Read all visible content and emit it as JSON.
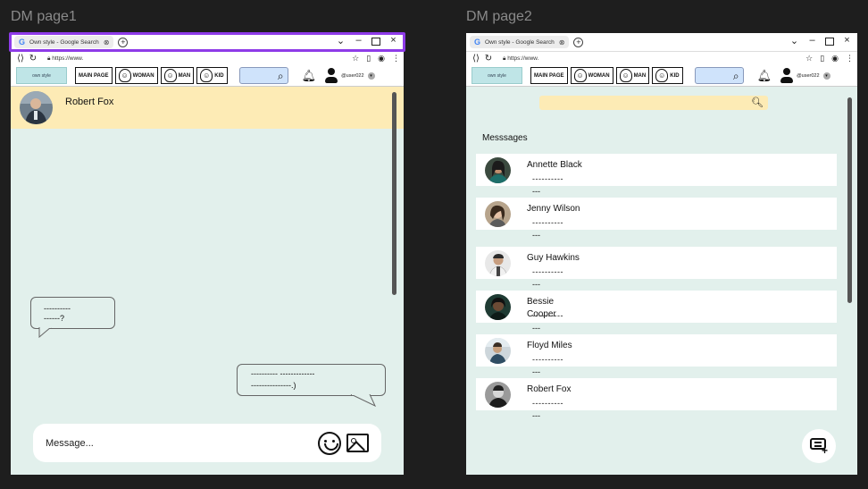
{
  "frames": [
    {
      "label": "DM page1"
    },
    {
      "label": "DM page2"
    }
  ],
  "browser": {
    "tab_title": "Own style - Google Search",
    "url": "https://www.",
    "google_letter": "G",
    "new_tab": "+",
    "close_x": "×"
  },
  "site": {
    "logo_text": "own style",
    "nav": [
      {
        "label": "MAIN PAGE",
        "icon": null
      },
      {
        "label": "WOMAN",
        "icon": "woman-face-icon"
      },
      {
        "label": "MAN",
        "icon": "man-face-icon"
      },
      {
        "label": "KID",
        "icon": "kid-face-icon"
      }
    ],
    "username": "@user022"
  },
  "dm1": {
    "contact_name": "Robert Fox",
    "received_message": "----------\n------?",
    "sent_message": "---------- -------------\n---------------.)",
    "input_placeholder": "Message..."
  },
  "dm2": {
    "section_title": "Messsages",
    "conversations": [
      {
        "name": "Annette Black",
        "preview1": "----------",
        "preview2": "---"
      },
      {
        "name": "Jenny Wilson",
        "preview1": "----------",
        "preview2": "---"
      },
      {
        "name": "Guy Hawkins",
        "preview1": "----------",
        "preview2": "---"
      },
      {
        "name": "Bessie\nCooper",
        "preview1": "----------",
        "preview2": "---"
      },
      {
        "name": "Floyd Miles",
        "preview1": "----------",
        "preview2": "---"
      },
      {
        "name": "Robert Fox",
        "preview1": "----------",
        "preview2": "---"
      }
    ]
  }
}
